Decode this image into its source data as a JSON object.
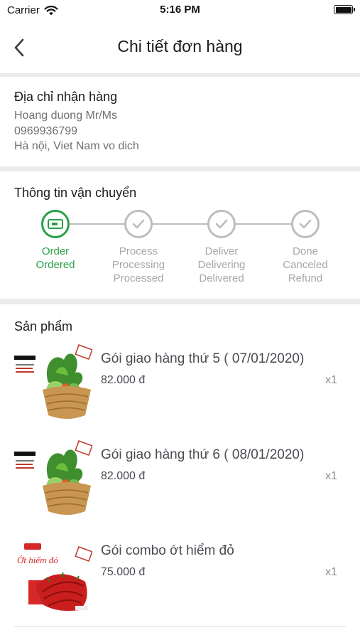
{
  "status_bar": {
    "carrier": "Carrier",
    "time": "5:16 PM"
  },
  "nav": {
    "title": "Chi tiết đơn hàng"
  },
  "address": {
    "title": "Địa chỉ nhận hàng",
    "name": "Hoang duong Mr/Ms",
    "phone": "0969936799",
    "location": "Hà nội, Viet Nam vo dich"
  },
  "shipping": {
    "title": "Thông tin vận chuyển",
    "steps": [
      {
        "lines": [
          "Order",
          "Ordered",
          ""
        ],
        "active": true,
        "icon": "card-icon"
      },
      {
        "lines": [
          "Process",
          "Processing",
          "Processed"
        ],
        "active": false,
        "icon": "check-icon"
      },
      {
        "lines": [
          "Deliver",
          "Delivering",
          "Delivered"
        ],
        "active": false,
        "icon": "check-icon"
      },
      {
        "lines": [
          "Done",
          "Canceled",
          "Refund"
        ],
        "active": false,
        "icon": "check-icon"
      }
    ]
  },
  "products": {
    "title": "Sản phẩm",
    "items": [
      {
        "name": "Gói giao hàng thứ 5 ( 07/01/2020)",
        "price": "82.000 đ",
        "qty": "x1",
        "image": "vegetable-basket-image"
      },
      {
        "name": "Gói giao hàng thứ 6 ( 08/01/2020)",
        "price": "82.000 đ",
        "qty": "x1",
        "image": "vegetable-basket-image"
      },
      {
        "name": "Gói combo ớt hiểm đỏ",
        "price": "75.000 đ",
        "qty": "x1",
        "image": "red-chili-image",
        "image_label": "Ớt hiểm đỏ"
      }
    ]
  },
  "colors": {
    "accent_green": "#2aa145",
    "inactive_gray": "#bdbdbd"
  }
}
